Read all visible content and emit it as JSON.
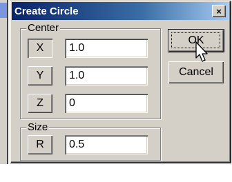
{
  "window": {
    "title": "Create Circle",
    "close_glyph": "×"
  },
  "center_group": {
    "label": "Center",
    "rows": [
      {
        "axis": "X",
        "value": "1.0"
      },
      {
        "axis": "Y",
        "value": "1.0"
      },
      {
        "axis": "Z",
        "value": "0"
      }
    ]
  },
  "size_group": {
    "label": "Size",
    "rows": [
      {
        "axis": "R",
        "value": "0.5"
      }
    ]
  },
  "buttons": {
    "ok": "OK",
    "cancel": "Cancel"
  },
  "icons": {
    "close": "close-icon",
    "cursor": "mouse-pointer-icon"
  },
  "colors": {
    "face": "#d4d0c8",
    "title_start": "#0a246a",
    "title_end": "#a6caf0"
  }
}
